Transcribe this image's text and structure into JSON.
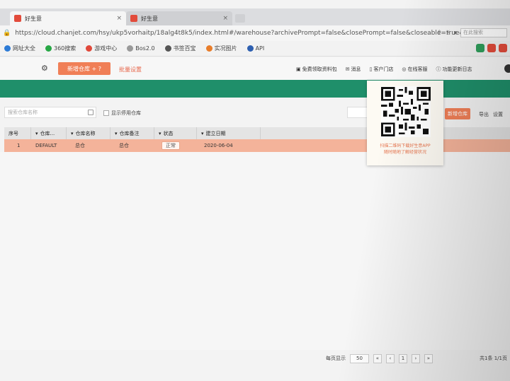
{
  "browser": {
    "tabs": [
      {
        "label": "好生意",
        "active": true
      },
      {
        "label": "好生意",
        "active": false
      }
    ],
    "url": "https://cloud.chanjet.com/hsy/ukp5vorhaitp/18alg4t8k5/index.html#/warehouse?archivePrompt=false&closePrompt=false&closeable=true&",
    "search_placeholder": "在此搜索"
  },
  "bookmarks": {
    "items": [
      {
        "label": "网址大全",
        "color": "#2d7bd6"
      },
      {
        "label": "360搜索",
        "color": "#27a745"
      },
      {
        "label": "游戏中心",
        "color": "#e0483a"
      },
      {
        "label": "Bos2.0",
        "color": "#999999"
      },
      {
        "label": "书签百宝",
        "color": "#555555"
      },
      {
        "label": "实况图片",
        "color": "#e87d2a"
      },
      {
        "label": "API",
        "color": "#2d5fb0"
      }
    ]
  },
  "app_header": {
    "create_button": "新增仓库 + ?",
    "red_link": "批量设置",
    "tools": [
      "免费领取资料包",
      "消息",
      "客户门店",
      "在线客服",
      "功能更新日志"
    ]
  },
  "filter": {
    "search_placeholder": "搜索仓库名称",
    "show_disabled": "显示停用仓库",
    "right_button": "新增仓库",
    "right_tools": [
      "导出",
      "设置"
    ]
  },
  "table": {
    "headers": [
      "序号",
      "仓库...",
      "仓库名称",
      "仓库备注",
      "状态",
      "建立日期"
    ],
    "rows": [
      [
        "1",
        "DEFAULT",
        "总仓",
        "总仓",
        "正常",
        "2020-06-04"
      ]
    ]
  },
  "qr_popup": {
    "caption_line1": "扫描二维码下载好生意APP",
    "caption_line2": "随时随地了解经营状况"
  },
  "pager": {
    "label": "每页显示",
    "page_size": "50",
    "page": "1",
    "summary": "共1条 1/1页"
  },
  "colors": {
    "accent": "#f07f57",
    "green_band": "#1f8f6a",
    "selected_row": "#f4b39a"
  }
}
